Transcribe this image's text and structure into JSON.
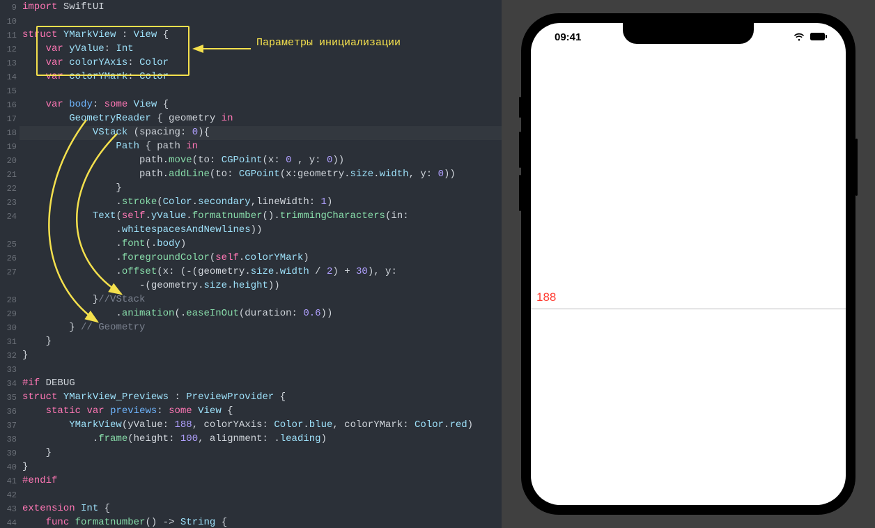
{
  "annotation_label": "Параметры инициализации",
  "preview": {
    "time": "09:41",
    "ymark_value": "188"
  },
  "gutter": [
    "9",
    "10",
    "11",
    "12",
    "13",
    "14",
    "15",
    "16",
    "17",
    "18",
    "19",
    "20",
    "21",
    "22",
    "23",
    "24",
    "",
    "25",
    "26",
    "27",
    "",
    "28",
    "29",
    "30",
    "31",
    "32",
    "33",
    "34",
    "35",
    "36",
    "37",
    "38",
    "39",
    "40",
    "41",
    "42",
    "43",
    "44"
  ],
  "code_lines": [
    [
      [
        "kw",
        "import"
      ],
      [
        "white",
        " SwiftUI"
      ]
    ],
    [],
    [
      [
        "kw",
        "struct"
      ],
      [
        "white",
        " "
      ],
      [
        "type",
        "YMarkView"
      ],
      [
        "white",
        " "
      ],
      [
        "punc",
        ":"
      ],
      [
        "white",
        " "
      ],
      [
        "type",
        "View"
      ],
      [
        "white",
        " "
      ],
      [
        "punc",
        "{"
      ]
    ],
    [
      [
        "white",
        "    "
      ],
      [
        "kw",
        "var"
      ],
      [
        "white",
        " "
      ],
      [
        "ident",
        "yValue"
      ],
      [
        "punc",
        ":"
      ],
      [
        "white",
        " "
      ],
      [
        "type",
        "Int"
      ]
    ],
    [
      [
        "white",
        "    "
      ],
      [
        "kw",
        "var"
      ],
      [
        "white",
        " "
      ],
      [
        "ident",
        "colorYAxis"
      ],
      [
        "punc",
        ":"
      ],
      [
        "white",
        " "
      ],
      [
        "type",
        "Color"
      ]
    ],
    [
      [
        "white",
        "    "
      ],
      [
        "kw",
        "var"
      ],
      [
        "white",
        " "
      ],
      [
        "ident",
        "colorYMark"
      ],
      [
        "punc",
        ":"
      ],
      [
        "white",
        " "
      ],
      [
        "type",
        "Color"
      ]
    ],
    [],
    [
      [
        "white",
        "    "
      ],
      [
        "kw",
        "var"
      ],
      [
        "white",
        " "
      ],
      [
        "bluename",
        "body"
      ],
      [
        "punc",
        ":"
      ],
      [
        "white",
        " "
      ],
      [
        "kw",
        "some"
      ],
      [
        "white",
        " "
      ],
      [
        "type",
        "View"
      ],
      [
        "white",
        " "
      ],
      [
        "punc",
        "{"
      ]
    ],
    [
      [
        "white",
        "        "
      ],
      [
        "type",
        "GeometryReader"
      ],
      [
        "white",
        " "
      ],
      [
        "punc",
        "{"
      ],
      [
        "white",
        " geometry "
      ],
      [
        "kw",
        "in"
      ]
    ],
    [
      [
        "white",
        "            "
      ],
      [
        "type",
        "VStack"
      ],
      [
        "white",
        " "
      ],
      [
        "punc",
        "("
      ],
      [
        "white",
        "spacing"
      ],
      [
        "punc",
        ":"
      ],
      [
        "white",
        " "
      ],
      [
        "lit",
        "0"
      ],
      [
        "punc",
        ")"
      ],
      [
        "punc",
        "{"
      ]
    ],
    [
      [
        "white",
        "                "
      ],
      [
        "type",
        "Path"
      ],
      [
        "white",
        " "
      ],
      [
        "punc",
        "{"
      ],
      [
        "white",
        " path "
      ],
      [
        "kw",
        "in"
      ]
    ],
    [
      [
        "white",
        "                    path"
      ],
      [
        "punc",
        "."
      ],
      [
        "fn",
        "move"
      ],
      [
        "punc",
        "("
      ],
      [
        "white",
        "to"
      ],
      [
        "punc",
        ":"
      ],
      [
        "white",
        " "
      ],
      [
        "type",
        "CGPoint"
      ],
      [
        "punc",
        "("
      ],
      [
        "white",
        "x"
      ],
      [
        "punc",
        ":"
      ],
      [
        "white",
        " "
      ],
      [
        "lit",
        "0"
      ],
      [
        "white",
        " "
      ],
      [
        "punc",
        ","
      ],
      [
        "white",
        " y"
      ],
      [
        "punc",
        ":"
      ],
      [
        "white",
        " "
      ],
      [
        "lit",
        "0"
      ],
      [
        "punc",
        "))"
      ]
    ],
    [
      [
        "white",
        "                    path"
      ],
      [
        "punc",
        "."
      ],
      [
        "fn",
        "addLine"
      ],
      [
        "punc",
        "("
      ],
      [
        "white",
        "to"
      ],
      [
        "punc",
        ":"
      ],
      [
        "white",
        " "
      ],
      [
        "type",
        "CGPoint"
      ],
      [
        "punc",
        "("
      ],
      [
        "white",
        "x"
      ],
      [
        "punc",
        ":"
      ],
      [
        "white",
        "geometry"
      ],
      [
        "punc",
        "."
      ],
      [
        "ident",
        "size"
      ],
      [
        "punc",
        "."
      ],
      [
        "ident",
        "width"
      ],
      [
        "punc",
        ","
      ],
      [
        "white",
        " y"
      ],
      [
        "punc",
        ":"
      ],
      [
        "white",
        " "
      ],
      [
        "lit",
        "0"
      ],
      [
        "punc",
        "))"
      ]
    ],
    [
      [
        "white",
        "                "
      ],
      [
        "punc",
        "}"
      ]
    ],
    [
      [
        "white",
        "                "
      ],
      [
        "punc",
        "."
      ],
      [
        "fn",
        "stroke"
      ],
      [
        "punc",
        "("
      ],
      [
        "type",
        "Color"
      ],
      [
        "punc",
        "."
      ],
      [
        "ident",
        "secondary"
      ],
      [
        "punc",
        ","
      ],
      [
        "white",
        "lineWidth"
      ],
      [
        "punc",
        ":"
      ],
      [
        "white",
        " "
      ],
      [
        "lit",
        "1"
      ],
      [
        "punc",
        ")"
      ]
    ],
    [
      [
        "white",
        "            "
      ],
      [
        "type",
        "Text"
      ],
      [
        "punc",
        "("
      ],
      [
        "kw",
        "self"
      ],
      [
        "punc",
        "."
      ],
      [
        "ident",
        "yValue"
      ],
      [
        "punc",
        "."
      ],
      [
        "fn",
        "formatnumber"
      ],
      [
        "punc",
        "()."
      ],
      [
        "fn",
        "trimmingCharacters"
      ],
      [
        "punc",
        "("
      ],
      [
        "white",
        "in"
      ],
      [
        "punc",
        ":"
      ]
    ],
    [
      [
        "white",
        "                "
      ],
      [
        "punc",
        "."
      ],
      [
        "ident",
        "whitespacesAndNewlines"
      ],
      [
        "punc",
        "))"
      ]
    ],
    [
      [
        "white",
        "                "
      ],
      [
        "punc",
        "."
      ],
      [
        "fn",
        "font"
      ],
      [
        "punc",
        "(."
      ],
      [
        "ident",
        "body"
      ],
      [
        "punc",
        ")"
      ]
    ],
    [
      [
        "white",
        "                "
      ],
      [
        "punc",
        "."
      ],
      [
        "fn",
        "foregroundColor"
      ],
      [
        "punc",
        "("
      ],
      [
        "kw",
        "self"
      ],
      [
        "punc",
        "."
      ],
      [
        "ident",
        "colorYMark"
      ],
      [
        "punc",
        ")"
      ]
    ],
    [
      [
        "white",
        "                "
      ],
      [
        "punc",
        "."
      ],
      [
        "fn",
        "offset"
      ],
      [
        "punc",
        "("
      ],
      [
        "white",
        "x"
      ],
      [
        "punc",
        ":"
      ],
      [
        "white",
        " "
      ],
      [
        "punc",
        "("
      ],
      [
        "punc",
        "-("
      ],
      [
        "white",
        "geometry"
      ],
      [
        "punc",
        "."
      ],
      [
        "ident",
        "size"
      ],
      [
        "punc",
        "."
      ],
      [
        "ident",
        "width"
      ],
      [
        "white",
        " "
      ],
      [
        "punc",
        "/"
      ],
      [
        "white",
        " "
      ],
      [
        "lit",
        "2"
      ],
      [
        "punc",
        ")"
      ],
      [
        "white",
        " "
      ],
      [
        "punc",
        "+"
      ],
      [
        "white",
        " "
      ],
      [
        "lit",
        "30"
      ],
      [
        "punc",
        ")"
      ],
      [
        "punc",
        ","
      ],
      [
        "white",
        " y"
      ],
      [
        "punc",
        ":"
      ]
    ],
    [
      [
        "white",
        "                    "
      ],
      [
        "punc",
        "-("
      ],
      [
        "white",
        "geometry"
      ],
      [
        "punc",
        "."
      ],
      [
        "ident",
        "size"
      ],
      [
        "punc",
        "."
      ],
      [
        "ident",
        "height"
      ],
      [
        "punc",
        "))"
      ]
    ],
    [
      [
        "white",
        "            "
      ],
      [
        "punc",
        "}"
      ],
      [
        "cmt",
        "//VStack"
      ]
    ],
    [
      [
        "white",
        "                "
      ],
      [
        "punc",
        "."
      ],
      [
        "fn",
        "animation"
      ],
      [
        "punc",
        "(."
      ],
      [
        "fn",
        "easeInOut"
      ],
      [
        "punc",
        "("
      ],
      [
        "white",
        "duration"
      ],
      [
        "punc",
        ":"
      ],
      [
        "white",
        " "
      ],
      [
        "lit",
        "0.6"
      ],
      [
        "punc",
        "))"
      ]
    ],
    [
      [
        "white",
        "        "
      ],
      [
        "punc",
        "}"
      ],
      [
        "white",
        " "
      ],
      [
        "cmt",
        "// Geometry"
      ]
    ],
    [
      [
        "white",
        "    "
      ],
      [
        "punc",
        "}"
      ]
    ],
    [
      [
        "punc",
        "}"
      ]
    ],
    [],
    [
      [
        "kw",
        "#if"
      ],
      [
        "white",
        " DEBUG"
      ]
    ],
    [
      [
        "kw",
        "struct"
      ],
      [
        "white",
        " "
      ],
      [
        "type",
        "YMarkView_Previews"
      ],
      [
        "white",
        " "
      ],
      [
        "punc",
        ":"
      ],
      [
        "white",
        " "
      ],
      [
        "type",
        "PreviewProvider"
      ],
      [
        "white",
        " "
      ],
      [
        "punc",
        "{"
      ]
    ],
    [
      [
        "white",
        "    "
      ],
      [
        "kw",
        "static"
      ],
      [
        "white",
        " "
      ],
      [
        "kw",
        "var"
      ],
      [
        "white",
        " "
      ],
      [
        "bluename",
        "previews"
      ],
      [
        "punc",
        ":"
      ],
      [
        "white",
        " "
      ],
      [
        "kw",
        "some"
      ],
      [
        "white",
        " "
      ],
      [
        "type",
        "View"
      ],
      [
        "white",
        " "
      ],
      [
        "punc",
        "{"
      ]
    ],
    [
      [
        "white",
        "        "
      ],
      [
        "type",
        "YMarkView"
      ],
      [
        "punc",
        "("
      ],
      [
        "white",
        "yValue"
      ],
      [
        "punc",
        ":"
      ],
      [
        "white",
        " "
      ],
      [
        "lit",
        "188"
      ],
      [
        "punc",
        ","
      ],
      [
        "white",
        " colorYAxis"
      ],
      [
        "punc",
        ":"
      ],
      [
        "white",
        " "
      ],
      [
        "type",
        "Color"
      ],
      [
        "punc",
        "."
      ],
      [
        "ident",
        "blue"
      ],
      [
        "punc",
        ","
      ],
      [
        "white",
        " colorYMark"
      ],
      [
        "punc",
        ":"
      ],
      [
        "white",
        " "
      ],
      [
        "type",
        "Color"
      ],
      [
        "punc",
        "."
      ],
      [
        "ident",
        "red"
      ],
      [
        "punc",
        ")"
      ]
    ],
    [
      [
        "white",
        "            "
      ],
      [
        "punc",
        "."
      ],
      [
        "fn",
        "frame"
      ],
      [
        "punc",
        "("
      ],
      [
        "white",
        "height"
      ],
      [
        "punc",
        ":"
      ],
      [
        "white",
        " "
      ],
      [
        "lit",
        "100"
      ],
      [
        "punc",
        ","
      ],
      [
        "white",
        " alignment"
      ],
      [
        "punc",
        ":"
      ],
      [
        "white",
        " "
      ],
      [
        "punc",
        "."
      ],
      [
        "ident",
        "leading"
      ],
      [
        "punc",
        ")"
      ]
    ],
    [
      [
        "white",
        "    "
      ],
      [
        "punc",
        "}"
      ]
    ],
    [
      [
        "punc",
        "}"
      ]
    ],
    [
      [
        "kw",
        "#endif"
      ]
    ],
    [],
    [
      [
        "kw",
        "extension"
      ],
      [
        "white",
        " "
      ],
      [
        "type",
        "Int"
      ],
      [
        "white",
        " "
      ],
      [
        "punc",
        "{"
      ]
    ],
    [
      [
        "white",
        "    "
      ],
      [
        "kw",
        "func"
      ],
      [
        "white",
        " "
      ],
      [
        "fn",
        "formatnumber"
      ],
      [
        "punc",
        "()"
      ],
      [
        "white",
        " "
      ],
      [
        "punc",
        "->"
      ],
      [
        "white",
        " "
      ],
      [
        "type",
        "String"
      ],
      [
        "white",
        " "
      ],
      [
        "punc",
        "{"
      ]
    ]
  ]
}
